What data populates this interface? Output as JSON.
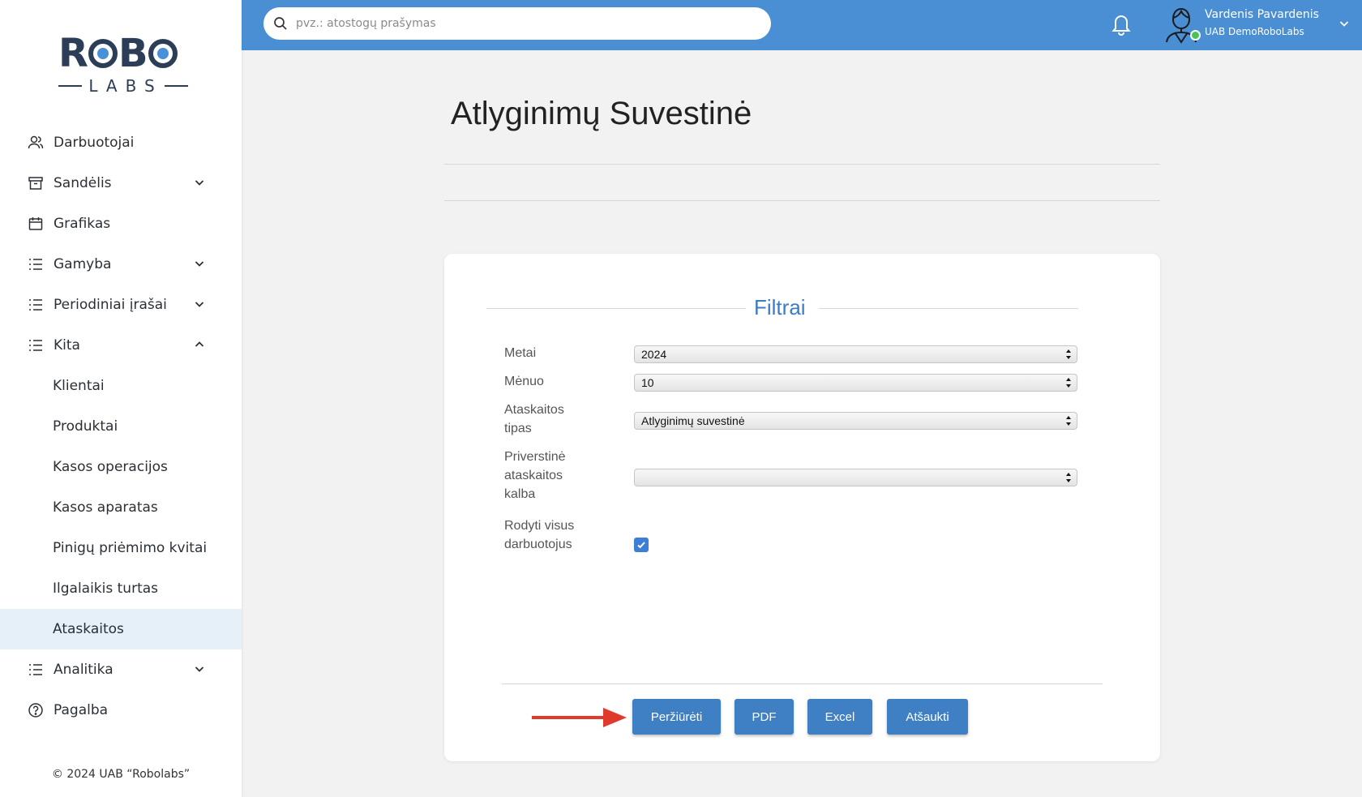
{
  "logo": {
    "top_text_a": "R",
    "top_text_b": "B",
    "bottom_text": "LABS"
  },
  "search": {
    "placeholder": "pvz.: atostogų prašymas"
  },
  "user": {
    "name": "Vardenis Pavardenis",
    "company": "UAB DemoRoboLabs"
  },
  "sidebar": {
    "items": [
      {
        "label": "Darbuotojai",
        "icon": "users-icon"
      },
      {
        "label": "Sandėlis",
        "icon": "archive-icon",
        "chevron": "down"
      },
      {
        "label": "Grafikas",
        "icon": "calendar-icon"
      },
      {
        "label": "Gamyba",
        "icon": "list-icon",
        "chevron": "down"
      },
      {
        "label": "Periodiniai įrašai",
        "icon": "list-icon",
        "chevron": "down"
      },
      {
        "label": "Kita",
        "icon": "list-icon",
        "chevron": "up"
      },
      {
        "label": "Klientai"
      },
      {
        "label": "Produktai"
      },
      {
        "label": "Kasos operacijos"
      },
      {
        "label": "Kasos aparatas"
      },
      {
        "label": "Pinigų priėmimo kvitai"
      },
      {
        "label": "Ilgalaikis turtas"
      },
      {
        "label": "Ataskaitos",
        "active": true
      },
      {
        "label": "Analitika",
        "icon": "list-icon",
        "chevron": "down"
      },
      {
        "label": "Pagalba",
        "icon": "help-icon"
      }
    ],
    "copyright": "© 2024 UAB “Robolabs”"
  },
  "main": {
    "title": "Atlyginimų Suvestinė",
    "legend": "Filtrai",
    "fields": {
      "year": {
        "label": "Metai",
        "value": "2024"
      },
      "month": {
        "label": "Mėnuo",
        "value": "10"
      },
      "report_type": {
        "label": "Ataskaitos tipas",
        "value": "Atlyginimų suvestinė"
      },
      "language": {
        "label": "Priverstinė ataskaitos kalba",
        "value": ""
      },
      "show_all": {
        "label": "Rodyti visus darbuotojus",
        "checked": true
      }
    },
    "buttons": {
      "view": "Peržiūrėti",
      "pdf": "PDF",
      "excel": "Excel",
      "cancel": "Atšaukti"
    }
  },
  "colors": {
    "accent": "#4a8fd4",
    "button": "#3f7fc3",
    "legend": "#3d7bc4",
    "arrow": "#e03a2c"
  }
}
